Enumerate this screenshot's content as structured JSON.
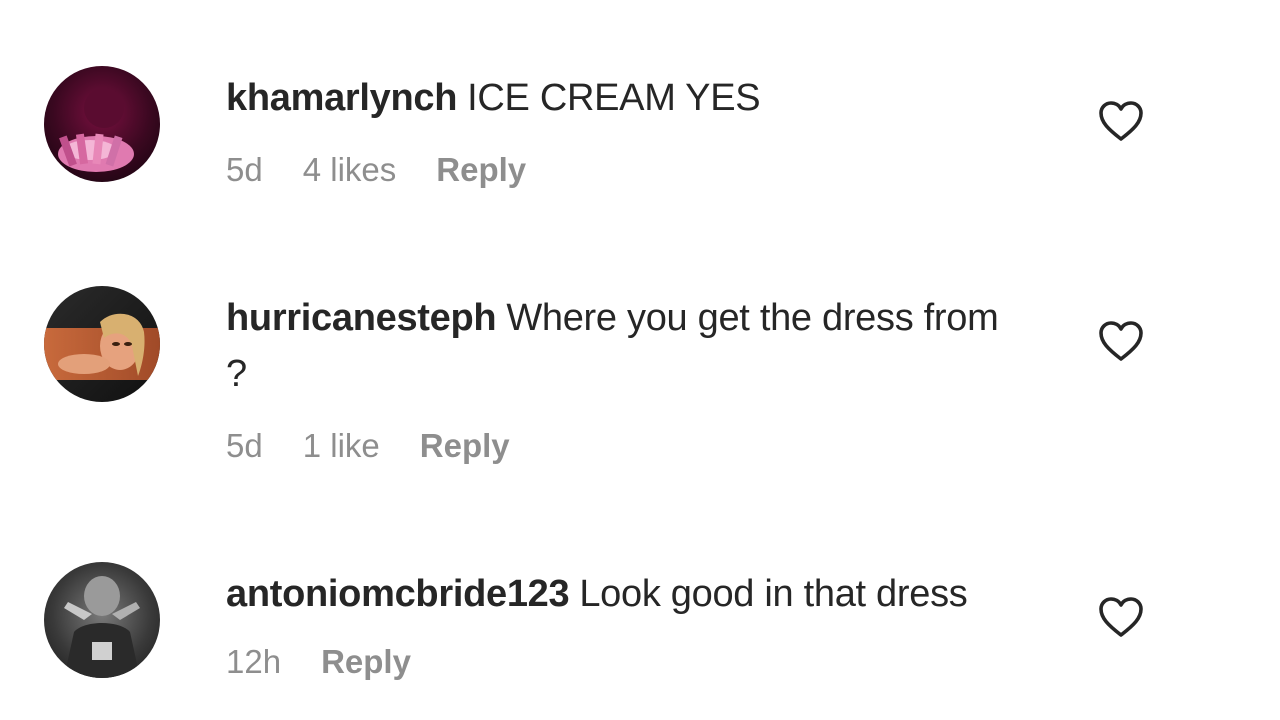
{
  "comments": [
    {
      "username": "khamarlynch",
      "text": "ICE CREAM YES",
      "time": "5d",
      "likes": "4 likes",
      "reply": "Reply",
      "like_icon": "heart-outline-icon"
    },
    {
      "username": "hurricanesteph",
      "text": "Where you get the dress from ?",
      "time": "5d",
      "likes": "1 like",
      "reply": "Reply",
      "like_icon": "heart-outline-icon"
    },
    {
      "username": "antoniomcbride123",
      "text": "Look good in that dress",
      "time": "12h",
      "likes": "",
      "reply": "Reply",
      "like_icon": "heart-outline-icon"
    }
  ],
  "colors": {
    "text": "#262626",
    "meta": "#8e8e8e",
    "background": "#ffffff"
  }
}
